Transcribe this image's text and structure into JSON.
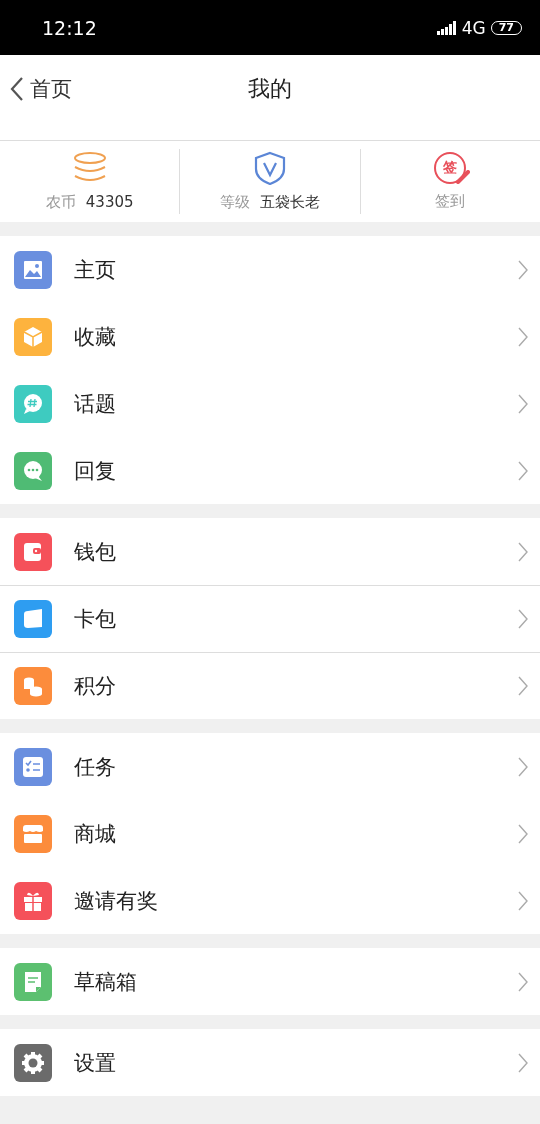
{
  "status_bar": {
    "time": "12:12",
    "network": "4G",
    "battery": "77"
  },
  "header": {
    "back_label": "首页",
    "title": "我的"
  },
  "stats": [
    {
      "kind": "coins",
      "label": "农币",
      "value": "43305"
    },
    {
      "kind": "level",
      "label": "等级",
      "value": "五袋长老"
    },
    {
      "kind": "checkin",
      "icon_text": "签",
      "label": "签到"
    }
  ],
  "menu_groups": [
    {
      "dividers": false,
      "items": [
        {
          "kind": "image",
          "color": "#6a8fdf",
          "label": "主页"
        },
        {
          "kind": "box",
          "color": "#fdb33e",
          "label": "收藏"
        },
        {
          "kind": "topic",
          "color": "#3ecbc0",
          "label": "话题"
        },
        {
          "kind": "reply",
          "color": "#4fbb74",
          "label": "回复"
        }
      ]
    },
    {
      "dividers": true,
      "items": [
        {
          "kind": "wallet",
          "color": "#f5515a",
          "label": "钱包"
        },
        {
          "kind": "card",
          "color": "#2e9df1",
          "label": "卡包"
        },
        {
          "kind": "points",
          "color": "#fc8c3c",
          "label": "积分"
        }
      ]
    },
    {
      "dividers": false,
      "items": [
        {
          "kind": "task",
          "color": "#6a8fdf",
          "label": "任务"
        },
        {
          "kind": "shop",
          "color": "#fc8c3c",
          "label": "商城"
        },
        {
          "kind": "gift",
          "color": "#f5515a",
          "label": "邀请有奖"
        }
      ]
    },
    {
      "items": [
        {
          "kind": "draft",
          "color": "#5cc070",
          "label": "草稿箱"
        }
      ]
    },
    {
      "items": [
        {
          "kind": "gear",
          "color": "#6b6b6b",
          "label": "设置"
        }
      ]
    }
  ]
}
